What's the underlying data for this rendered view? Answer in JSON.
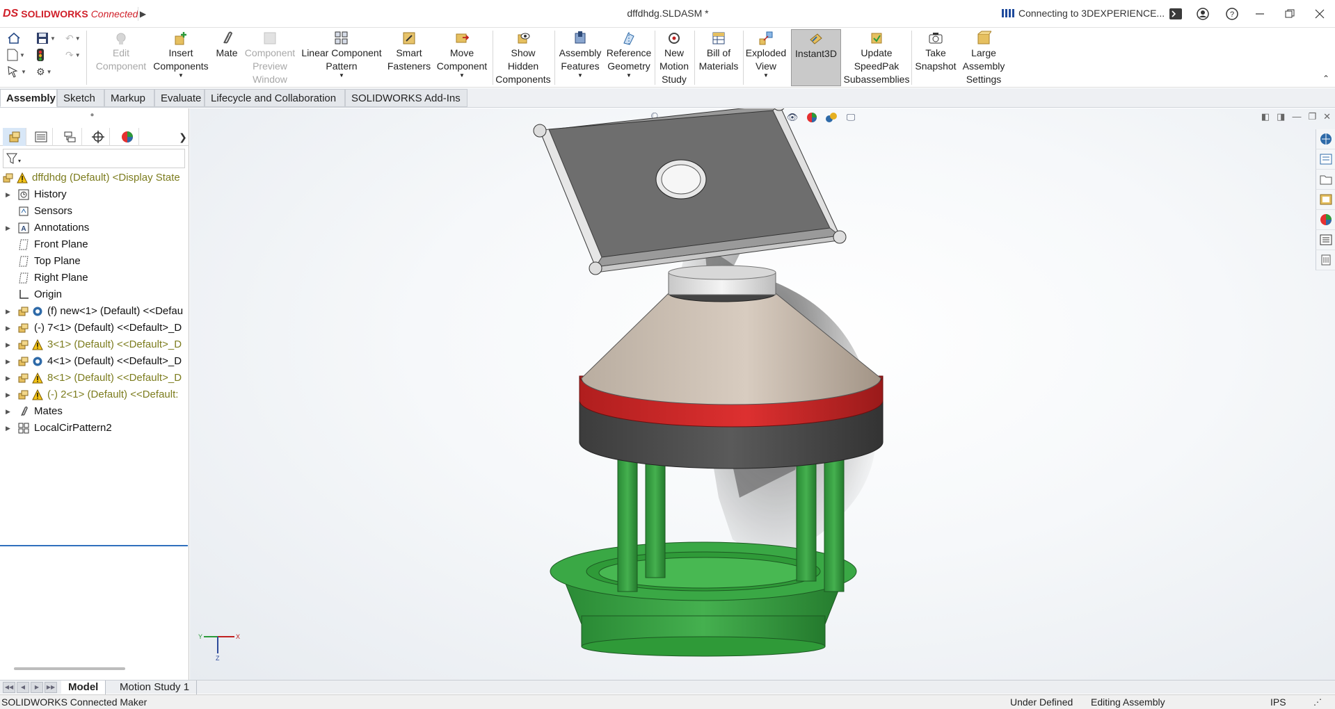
{
  "app": {
    "brand_ds": "DS",
    "brand_name": "SOLIDWORKS",
    "brand_suffix": "Connected",
    "document_title": "dffdhdg.SLDASM *",
    "connection_status": "Connecting to 3DEXPERIENCE...",
    "accent_color": "#d0202a"
  },
  "ribbon": {
    "buttons": [
      {
        "id": "edit-component",
        "label": "Edit Component",
        "disabled": true
      },
      {
        "id": "insert-components",
        "label": "Insert Components",
        "dropdown": true
      },
      {
        "id": "mate",
        "label": "Mate"
      },
      {
        "id": "component-preview-window",
        "label": "Component Preview Window",
        "disabled": true
      },
      {
        "id": "linear-component-pattern",
        "label": "Linear Component Pattern",
        "dropdown": true
      },
      {
        "id": "smart-fasteners",
        "label": "Smart Fasteners"
      },
      {
        "id": "move-component",
        "label": "Move Component",
        "dropdown": true
      },
      {
        "id": "show-hidden-components",
        "label": "Show Hidden Components"
      },
      {
        "id": "assembly-features",
        "label": "Assembly Features",
        "dropdown": true
      },
      {
        "id": "reference-geometry",
        "label": "Reference Geometry",
        "dropdown": true
      },
      {
        "id": "new-motion-study",
        "label": "New Motion Study"
      },
      {
        "id": "bill-of-materials",
        "label": "Bill of Materials"
      },
      {
        "id": "exploded-view",
        "label": "Exploded View",
        "dropdown": true
      },
      {
        "id": "instant3d",
        "label": "Instant3D",
        "active": true
      },
      {
        "id": "update-speedpak",
        "label": "Update SpeedPak Subassemblies"
      },
      {
        "id": "take-snapshot",
        "label": "Take Snapshot"
      },
      {
        "id": "large-assembly-settings",
        "label": "Large Assembly Settings"
      }
    ]
  },
  "tabs": [
    {
      "label": "Assembly",
      "active": true
    },
    {
      "label": "Sketch"
    },
    {
      "label": "Markup"
    },
    {
      "label": "Evaluate"
    },
    {
      "label": "Lifecycle and Collaboration"
    },
    {
      "label": "SOLIDWORKS Add-Ins"
    }
  ],
  "tree": {
    "items": [
      {
        "label": "dffdhdg (Default) <Display State",
        "warn": true,
        "icon": "assembly-warning-icon"
      },
      {
        "label": "History",
        "icon": "history-icon",
        "expand": true
      },
      {
        "label": "Sensors",
        "icon": "sensors-icon"
      },
      {
        "label": "Annotations",
        "icon": "annotations-icon",
        "expand": true
      },
      {
        "label": "Front Plane",
        "icon": "plane-icon"
      },
      {
        "label": "Top Plane",
        "icon": "plane-icon"
      },
      {
        "label": "Right Plane",
        "icon": "plane-icon"
      },
      {
        "label": "Origin",
        "icon": "origin-icon"
      },
      {
        "label": "(f) new<1> (Default) <<Defau",
        "icon": "part-icon",
        "expand": true
      },
      {
        "label": "(-) 7<1> (Default) <<Default>_D",
        "icon": "part-icon",
        "expand": true
      },
      {
        "label": "3<1> (Default) <<Default>_D",
        "icon": "part-warning-icon",
        "expand": true,
        "warn": true
      },
      {
        "label": "4<1> (Default) <<Default>_D",
        "icon": "part-icon",
        "expand": true
      },
      {
        "label": "8<1> (Default) <<Default>_D",
        "icon": "part-warning-icon",
        "expand": true,
        "warn": true
      },
      {
        "label": "(-) 2<1> (Default) <<Default:",
        "icon": "part-warning-icon",
        "expand": true,
        "warn": true
      },
      {
        "label": "Mates",
        "icon": "mates-icon",
        "expand": true
      },
      {
        "label": "LocalCirPattern2",
        "icon": "pattern-icon",
        "expand": true
      }
    ]
  },
  "triad": {
    "x_label": "X",
    "y_label": "Y",
    "z_label": "Z"
  },
  "bottom_tabs": [
    {
      "label": "Model",
      "active": true
    },
    {
      "label": "Motion Study 1"
    }
  ],
  "status": {
    "left": "SOLIDWORKS Connected Maker",
    "definition": "Under Defined",
    "mode": "Editing Assembly",
    "units": "IPS"
  }
}
